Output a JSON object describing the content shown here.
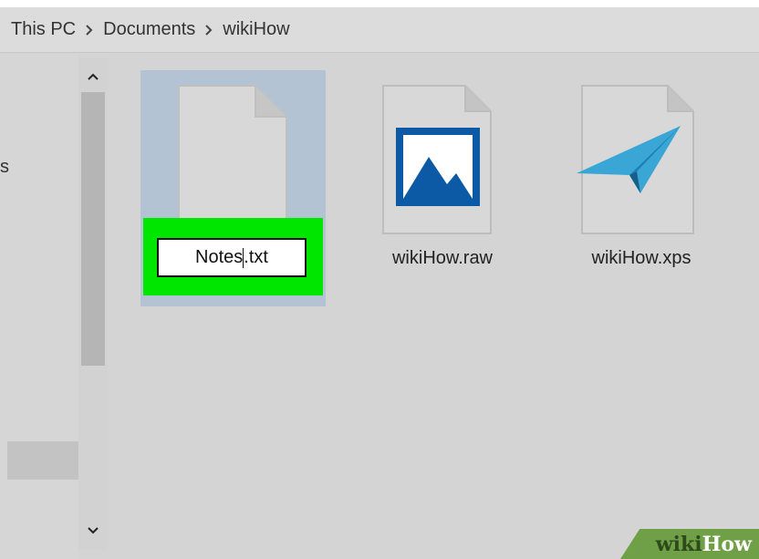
{
  "breadcrumb": {
    "items": [
      "This PC",
      "Documents",
      "wikiHow"
    ]
  },
  "nav": {
    "partial_label": "s"
  },
  "files": [
    {
      "name_before_caret": "Notes",
      "name_after_caret": ".txt",
      "icon": "blank-document-icon",
      "state": "renaming"
    },
    {
      "name": "wikiHow.raw",
      "icon": "image-file-icon"
    },
    {
      "name": "wikiHow.xps",
      "icon": "xps-document-icon"
    }
  ],
  "colors": {
    "selection": "#b3c3d4",
    "rename_highlight": "#00e600",
    "raw_icon_blue": "#0c5aa6",
    "xps_icon_blue": "#3aa6d6"
  },
  "watermark": {
    "part1": "wiki",
    "part2": "How"
  }
}
